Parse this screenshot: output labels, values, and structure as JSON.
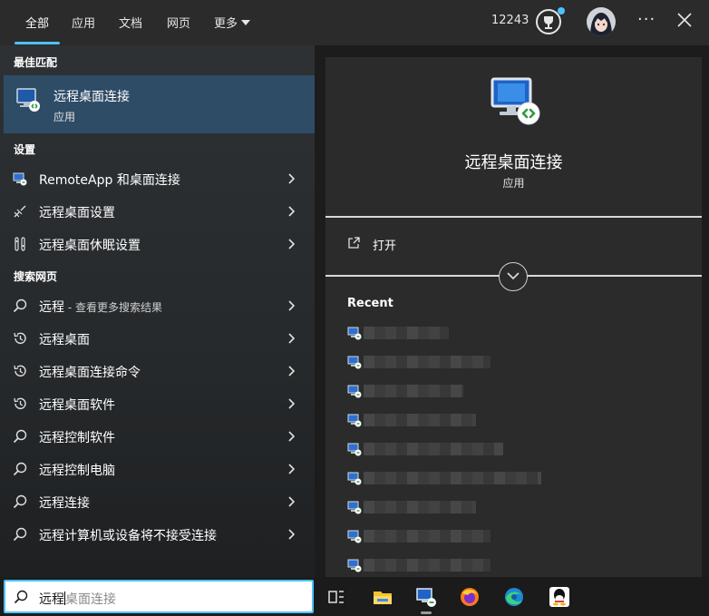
{
  "tabs": [
    {
      "label": "全部",
      "active": true
    },
    {
      "label": "应用"
    },
    {
      "label": "文档"
    },
    {
      "label": "网页"
    },
    {
      "label": "更多"
    }
  ],
  "header": {
    "points": "12243",
    "trophy_icon": "trophy-icon",
    "more_options_icon": "ellipsis-icon",
    "close_icon": "close-icon"
  },
  "best_match": {
    "section_title": "最佳匹配",
    "name": "远程桌面连接",
    "type": "应用"
  },
  "settings": {
    "section_title": "设置",
    "items": [
      {
        "label": "RemoteApp 和桌面连接",
        "icon": "remoteapp-icon"
      },
      {
        "label": "远程桌面设置",
        "icon": "remote-desktop-settings-icon"
      },
      {
        "label": "远程桌面休眠设置",
        "icon": "sleep-settings-icon"
      }
    ]
  },
  "web": {
    "section_title": "搜索网页",
    "first": {
      "label": "远程",
      "sub": " - 查看更多搜索结果"
    },
    "items": [
      {
        "label": "远程桌面",
        "icon": "history-icon"
      },
      {
        "label": "远程桌面连接命令",
        "icon": "history-icon"
      },
      {
        "label": "远程桌面软件",
        "icon": "history-icon"
      },
      {
        "label": "远程控制软件",
        "icon": "search-icon"
      },
      {
        "label": "远程控制电脑",
        "icon": "search-icon"
      },
      {
        "label": "远程连接",
        "icon": "search-icon"
      },
      {
        "label": "远程计算机或设备将不接受连接",
        "icon": "search-icon"
      }
    ]
  },
  "detail": {
    "app_name": "远程桌面连接",
    "app_type": "应用",
    "open_label": "打开",
    "recent_title": "Recent"
  },
  "search": {
    "typed": "远程",
    "suggestion": "桌面连接"
  },
  "taskbar": {
    "icons": [
      "task-view-icon",
      "file-explorer-icon",
      "remote-desktop-icon",
      "firefox-icon",
      "edge-icon",
      "qq-icon"
    ]
  },
  "colors": {
    "accent": "#4cc2ff",
    "selected_row": "#2f4c66",
    "panel": "#2b2b2b"
  }
}
